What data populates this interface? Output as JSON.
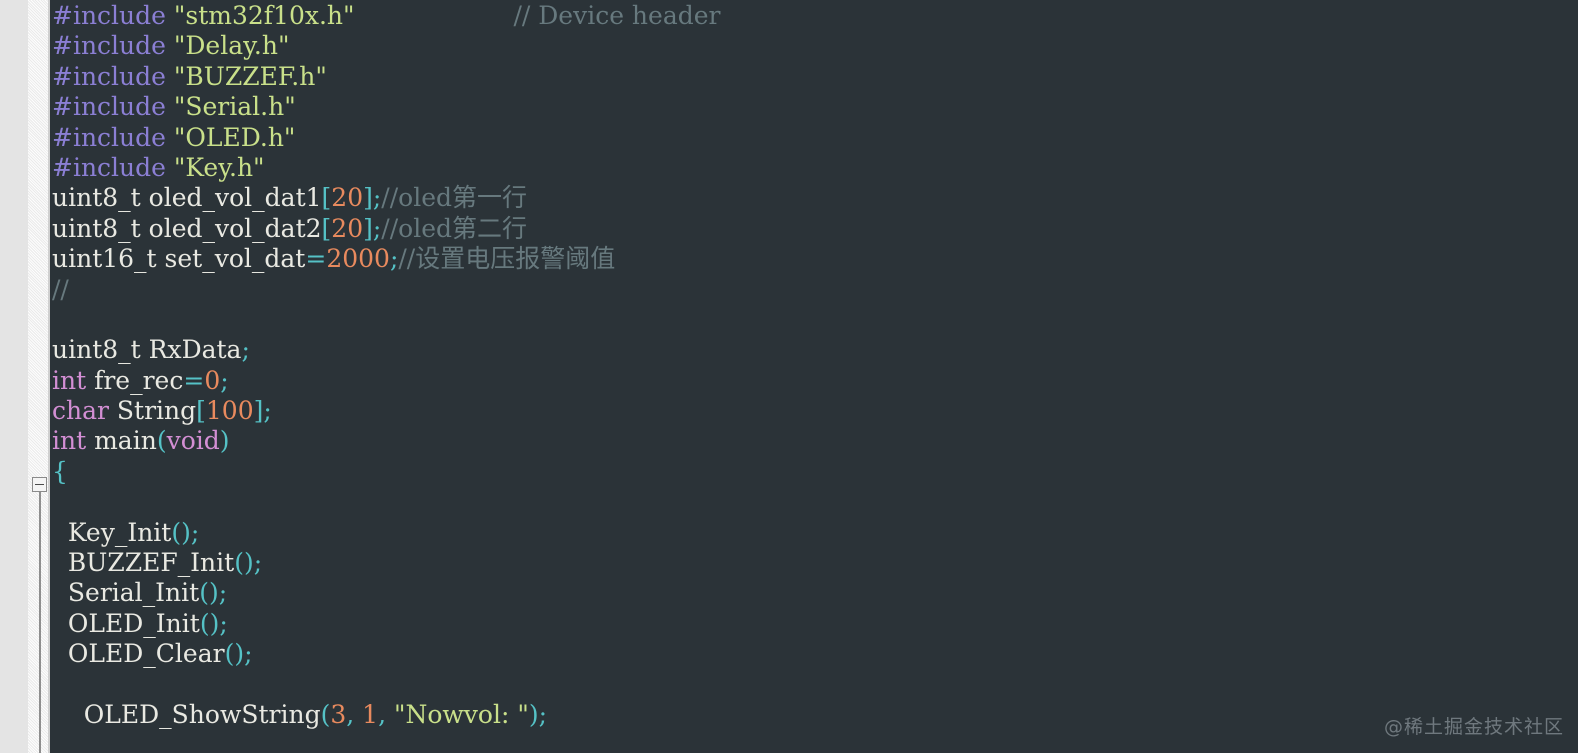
{
  "editor": {
    "background_color": "#2b3338",
    "gutter_color": "#e6e6e6",
    "language": "C",
    "font_size_px": 25,
    "line_height_px": 30.4
  },
  "colors": {
    "preprocessor": "#8b7fd4",
    "string": "#c9e08a",
    "comment": "#67797e",
    "keyword": "#d38fd4",
    "number": "#e88a5e",
    "punctuation": "#55c2c6",
    "identifier": "#e9e9e2",
    "watermark": "#b4bec3"
  },
  "gutter": {
    "fold_marker": {
      "state": "expanded",
      "glyph": "minus-box-icon",
      "line_index": 15
    }
  },
  "watermark": {
    "text": "@稀土掘金技术社区"
  },
  "code": {
    "lines": [
      {
        "index": 0,
        "text": "#include \"stm32f10x.h\"                     // Device header",
        "tokens": [
          {
            "t": "#include ",
            "c": "tok-pre"
          },
          {
            "t": "\"stm32f10x.h\"",
            "c": "tok-str"
          },
          {
            "t": "                    ",
            "c": "tok-ident"
          },
          {
            "t": "// Device header",
            "c": "tok-cmt"
          }
        ]
      },
      {
        "index": 1,
        "text": "#include \"Delay.h\"",
        "tokens": [
          {
            "t": "#include ",
            "c": "tok-pre"
          },
          {
            "t": "\"Delay.h\"",
            "c": "tok-str"
          }
        ]
      },
      {
        "index": 2,
        "text": "#include \"BUZZEF.h\"",
        "tokens": [
          {
            "t": "#include ",
            "c": "tok-pre"
          },
          {
            "t": "\"BUZZEF.h\"",
            "c": "tok-str"
          }
        ]
      },
      {
        "index": 3,
        "text": "#include \"Serial.h\"",
        "tokens": [
          {
            "t": "#include ",
            "c": "tok-pre"
          },
          {
            "t": "\"Serial.h\"",
            "c": "tok-str"
          }
        ]
      },
      {
        "index": 4,
        "text": "#include \"OLED.h\"",
        "tokens": [
          {
            "t": "#include ",
            "c": "tok-pre"
          },
          {
            "t": "\"OLED.h\"",
            "c": "tok-str"
          }
        ]
      },
      {
        "index": 5,
        "text": "#include \"Key.h\"",
        "tokens": [
          {
            "t": "#include ",
            "c": "tok-pre"
          },
          {
            "t": "\"Key.h\"",
            "c": "tok-str"
          }
        ]
      },
      {
        "index": 6,
        "text": "uint8_t oled_vol_dat1[20];//oled第一行",
        "tokens": [
          {
            "t": "uint8_t oled_vol_dat1",
            "c": "tok-type"
          },
          {
            "t": "[",
            "c": "tok-punct"
          },
          {
            "t": "20",
            "c": "tok-num"
          },
          {
            "t": "];",
            "c": "tok-punct"
          },
          {
            "t": "//oled第一行",
            "c": "tok-cmt"
          }
        ]
      },
      {
        "index": 7,
        "text": "uint8_t oled_vol_dat2[20];//oled第二行",
        "tokens": [
          {
            "t": "uint8_t oled_vol_dat2",
            "c": "tok-type"
          },
          {
            "t": "[",
            "c": "tok-punct"
          },
          {
            "t": "20",
            "c": "tok-num"
          },
          {
            "t": "];",
            "c": "tok-punct"
          },
          {
            "t": "//oled第二行",
            "c": "tok-cmt"
          }
        ]
      },
      {
        "index": 8,
        "text": "uint16_t set_vol_dat=2000;//设置电压报警阈值",
        "tokens": [
          {
            "t": "uint16_t set_vol_dat",
            "c": "tok-type"
          },
          {
            "t": "=",
            "c": "tok-punct"
          },
          {
            "t": "2000",
            "c": "tok-num"
          },
          {
            "t": ";",
            "c": "tok-punct"
          },
          {
            "t": "//设置电压报警阈值",
            "c": "tok-cmt"
          }
        ]
      },
      {
        "index": 9,
        "text": "//",
        "tokens": [
          {
            "t": "//",
            "c": "tok-cmt"
          }
        ]
      },
      {
        "index": 10,
        "text": "",
        "tokens": []
      },
      {
        "index": 11,
        "text": "uint8_t RxData;",
        "tokens": [
          {
            "t": "uint8_t RxData",
            "c": "tok-type"
          },
          {
            "t": ";",
            "c": "tok-punct"
          }
        ]
      },
      {
        "index": 12,
        "text": "int fre_rec=0;",
        "tokens": [
          {
            "t": "int",
            "c": "tok-kw"
          },
          {
            "t": " fre_rec",
            "c": "tok-ident"
          },
          {
            "t": "=",
            "c": "tok-punct"
          },
          {
            "t": "0",
            "c": "tok-num"
          },
          {
            "t": ";",
            "c": "tok-punct"
          }
        ]
      },
      {
        "index": 13,
        "text": "char String[100];",
        "tokens": [
          {
            "t": "char",
            "c": "tok-kw"
          },
          {
            "t": " String",
            "c": "tok-ident"
          },
          {
            "t": "[",
            "c": "tok-punct"
          },
          {
            "t": "100",
            "c": "tok-num"
          },
          {
            "t": "];",
            "c": "tok-punct"
          }
        ]
      },
      {
        "index": 14,
        "text": "int main(void)",
        "tokens": [
          {
            "t": "int",
            "c": "tok-kw"
          },
          {
            "t": " main",
            "c": "tok-ident"
          },
          {
            "t": "(",
            "c": "tok-punct"
          },
          {
            "t": "void",
            "c": "tok-kw"
          },
          {
            "t": ")",
            "c": "tok-punct"
          }
        ]
      },
      {
        "index": 15,
        "text": "{",
        "tokens": [
          {
            "t": "{",
            "c": "tok-punct"
          }
        ]
      },
      {
        "index": 16,
        "text": "",
        "tokens": []
      },
      {
        "index": 17,
        "text": "  Key_Init();",
        "tokens": [
          {
            "t": "  Key_Init",
            "c": "tok-ident"
          },
          {
            "t": "();",
            "c": "tok-punct"
          }
        ]
      },
      {
        "index": 18,
        "text": "  BUZZEF_Init();",
        "tokens": [
          {
            "t": "  BUZZEF_Init",
            "c": "tok-ident"
          },
          {
            "t": "();",
            "c": "tok-punct"
          }
        ]
      },
      {
        "index": 19,
        "text": "  Serial_Init();",
        "tokens": [
          {
            "t": "  Serial_Init",
            "c": "tok-ident"
          },
          {
            "t": "();",
            "c": "tok-punct"
          }
        ]
      },
      {
        "index": 20,
        "text": "  OLED_Init();",
        "tokens": [
          {
            "t": "  OLED_Init",
            "c": "tok-ident"
          },
          {
            "t": "();",
            "c": "tok-punct"
          }
        ]
      },
      {
        "index": 21,
        "text": "  OLED_Clear();",
        "tokens": [
          {
            "t": "  OLED_Clear",
            "c": "tok-ident"
          },
          {
            "t": "();",
            "c": "tok-punct"
          }
        ]
      },
      {
        "index": 22,
        "text": "",
        "tokens": []
      },
      {
        "index": 23,
        "text": "    OLED_ShowString(3, 1, \"Nowvol: \");",
        "tokens": [
          {
            "t": "    OLED_ShowString",
            "c": "tok-ident"
          },
          {
            "t": "(",
            "c": "tok-punct"
          },
          {
            "t": "3",
            "c": "tok-num"
          },
          {
            "t": ", ",
            "c": "tok-punct"
          },
          {
            "t": "1",
            "c": "tok-num"
          },
          {
            "t": ", ",
            "c": "tok-punct"
          },
          {
            "t": "\"Nowvol: \"",
            "c": "tok-str"
          },
          {
            "t": ");",
            "c": "tok-punct"
          }
        ]
      }
    ]
  }
}
